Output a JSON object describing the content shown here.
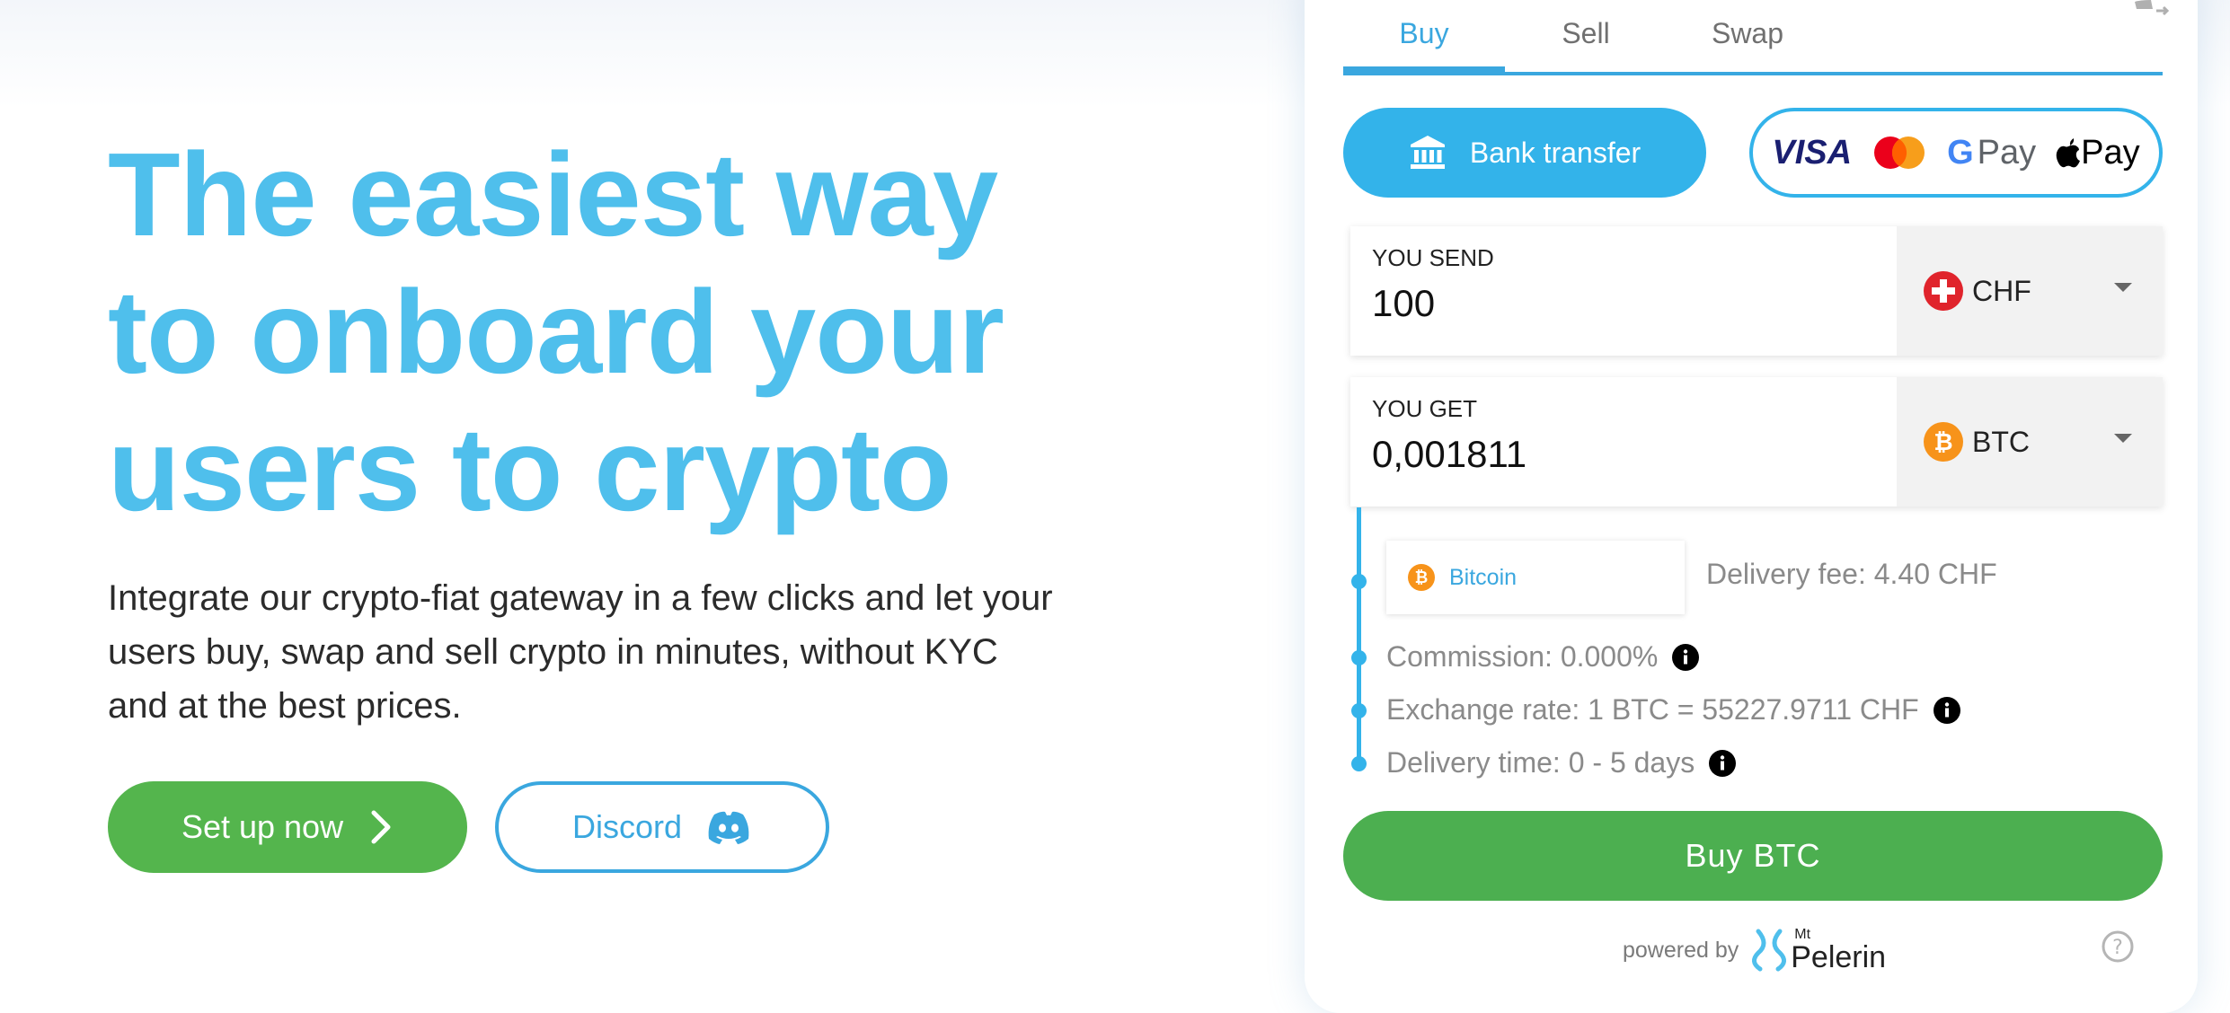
{
  "hero": {
    "title_line1": "The easiest way",
    "title_line2": "to onboard your",
    "title_line3": "users to crypto",
    "description": "Integrate our crypto-fiat gateway in a few clicks and let your users buy, swap and sell crypto in minutes, without KYC and at the best prices.",
    "setup_label": "Set up now",
    "discord_label": "Discord"
  },
  "widget": {
    "tabs": [
      {
        "label": "Buy",
        "active": true
      },
      {
        "label": "Sell",
        "active": false
      },
      {
        "label": "Swap",
        "active": false
      }
    ],
    "payment": {
      "bank_label": "Bank transfer",
      "card_brands": [
        "VISA",
        "Mastercard",
        "G Pay",
        "Apple Pay"
      ],
      "visa_text": "VISA",
      "gpay_g": "G",
      "gpay_text": "Pay",
      "apay_text": "Pay"
    },
    "send": {
      "label": "YOU SEND",
      "value": "100",
      "currency": "CHF",
      "icon": "swiss-flag-icon"
    },
    "get": {
      "label": "YOU GET",
      "value": "0,001811",
      "currency": "BTC",
      "icon": "bitcoin-icon"
    },
    "network": {
      "label": "Bitcoin",
      "icon": "bitcoin-icon"
    },
    "delivery_fee": "Delivery fee: 4.40 CHF",
    "commission": "Commission: 0.000%",
    "exchange_rate": "Exchange rate: 1 BTC = 55227.9711 CHF",
    "delivery_time": "Delivery time: 0 - 5 days",
    "buy_button": "Buy BTC",
    "powered_by": "powered by",
    "brand_small": "Mt",
    "brand_name": "Pelerin"
  },
  "colors": {
    "accent_blue": "#33b3ea",
    "title_blue": "#4fbfec",
    "green": "#4caf50",
    "bitcoin_orange": "#f7931a",
    "swiss_red": "#e0242c"
  }
}
